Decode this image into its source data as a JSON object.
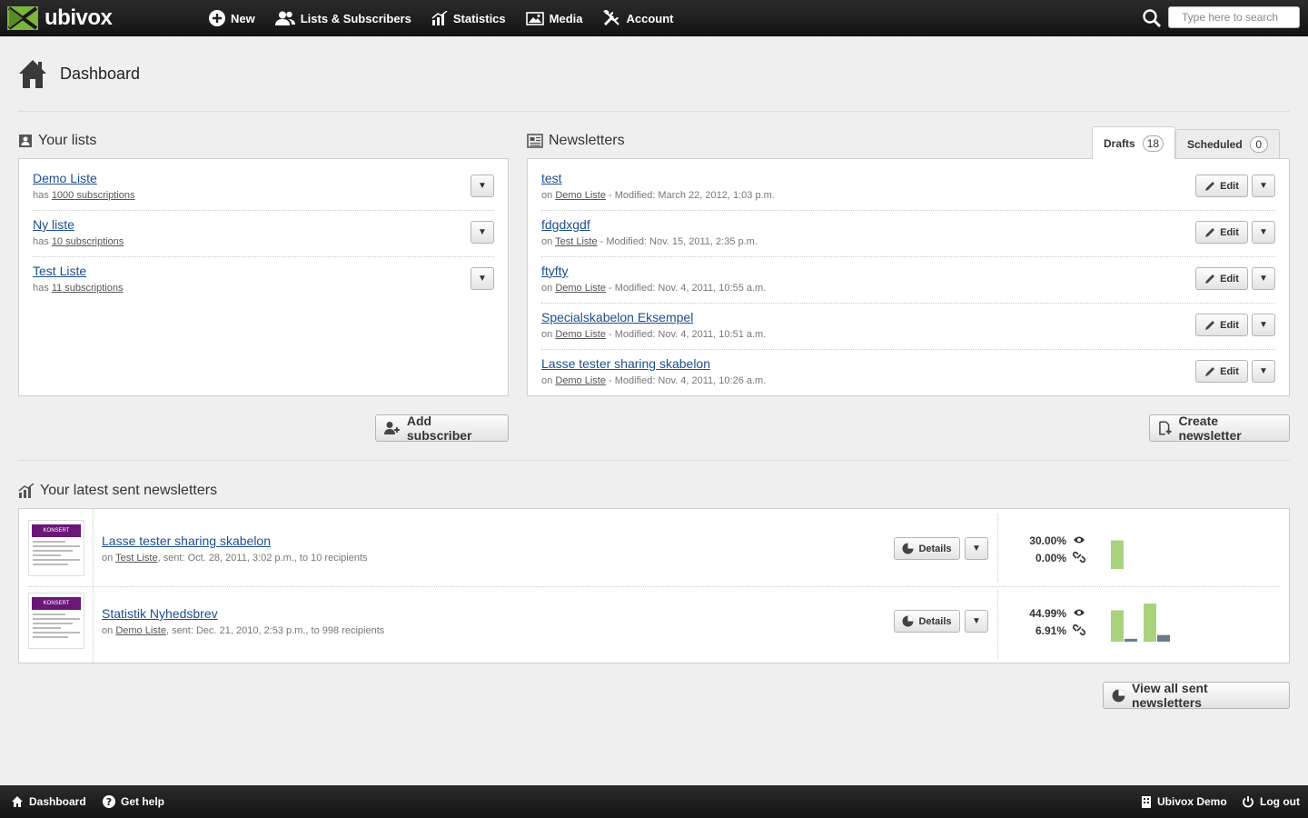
{
  "app": {
    "name": "ubivox",
    "brand_color": "#7db53c"
  },
  "nav": [
    {
      "label": "New",
      "icon": "plus-circle-icon"
    },
    {
      "label": "Lists & Subscribers",
      "icon": "users-icon"
    },
    {
      "label": "Statistics",
      "icon": "bar-chart-icon"
    },
    {
      "label": "Media",
      "icon": "image-icon"
    },
    {
      "label": "Account",
      "icon": "tools-icon"
    }
  ],
  "search": {
    "placeholder": "Type here to search"
  },
  "page": {
    "title": "Dashboard"
  },
  "lists": {
    "title": "Your lists",
    "items": [
      {
        "name": "Demo Liste",
        "prefix": "has",
        "subs": "1000 subscriptions"
      },
      {
        "name": "Ny liste",
        "prefix": "has",
        "subs": "10 subscriptions"
      },
      {
        "name": "Test Liste",
        "prefix": "has",
        "subs": "11 subscriptions"
      }
    ],
    "add_button": "Add subscriber"
  },
  "newsletters": {
    "title": "Newsletters",
    "tabs": [
      {
        "label": "Drafts",
        "count": "18"
      },
      {
        "label": "Scheduled",
        "count": "0"
      }
    ],
    "edit_label": "Edit",
    "items": [
      {
        "name": "test",
        "on": "on",
        "list": "Demo Liste",
        "modified": "- Modified: March 22, 2012, 1:03 p.m."
      },
      {
        "name": "fdgdxgdf",
        "on": "on",
        "list": "Test Liste",
        "modified": "- Modified: Nov. 15, 2011, 2:35 p.m."
      },
      {
        "name": "ftyfty",
        "on": "on",
        "list": "Demo Liste",
        "modified": "- Modified: Nov. 4, 2011, 10:55 a.m."
      },
      {
        "name": "Specialskabelon Eksempel",
        "on": "on",
        "list": "Demo Liste",
        "modified": "- Modified: Nov. 4, 2011, 10:51 a.m."
      },
      {
        "name": "Lasse tester sharing skabelon",
        "on": "on",
        "list": "Demo Liste",
        "modified": "- Modified: Nov. 4, 2011, 10:26 a.m."
      }
    ],
    "create_button": "Create newsletter"
  },
  "sent": {
    "title": "Your latest sent newsletters",
    "details_label": "Details",
    "items": [
      {
        "name": "Lasse tester sharing skabelon",
        "on": "on",
        "list": "Test Liste",
        "info": ", sent: Oct. 28, 2011, 3:02 p.m., to 10 recipients",
        "open_rate": "30.00%",
        "click_rate": "0.00%",
        "thumb_text": "KONSERT",
        "bars": [
          {
            "open": 0.3,
            "click": 0.0
          }
        ]
      },
      {
        "name": "Statistik Nyhedsbrev",
        "on": "on",
        "list": "Demo Liste",
        "info": ", sent: Dec. 21, 2010, 2:53 p.m., to 998 recipients",
        "open_rate": "44.99%",
        "click_rate": "6.91%",
        "thumb_text": "KONSERT",
        "bars": [
          {
            "open": 0.33,
            "click": 0.03
          },
          {
            "open": 0.4,
            "click": 0.07
          }
        ]
      }
    ],
    "view_all_button": "View all sent newsletters",
    "open_color": "#a8d27b",
    "click_color": "#6b7b8e"
  },
  "footer": {
    "left": [
      {
        "label": "Dashboard",
        "icon": "home-icon"
      },
      {
        "label": "Get help",
        "icon": "help-icon"
      }
    ],
    "right": [
      {
        "label": "Ubivox Demo",
        "icon": "building-icon"
      },
      {
        "label": "Log out",
        "icon": "power-icon"
      }
    ]
  }
}
